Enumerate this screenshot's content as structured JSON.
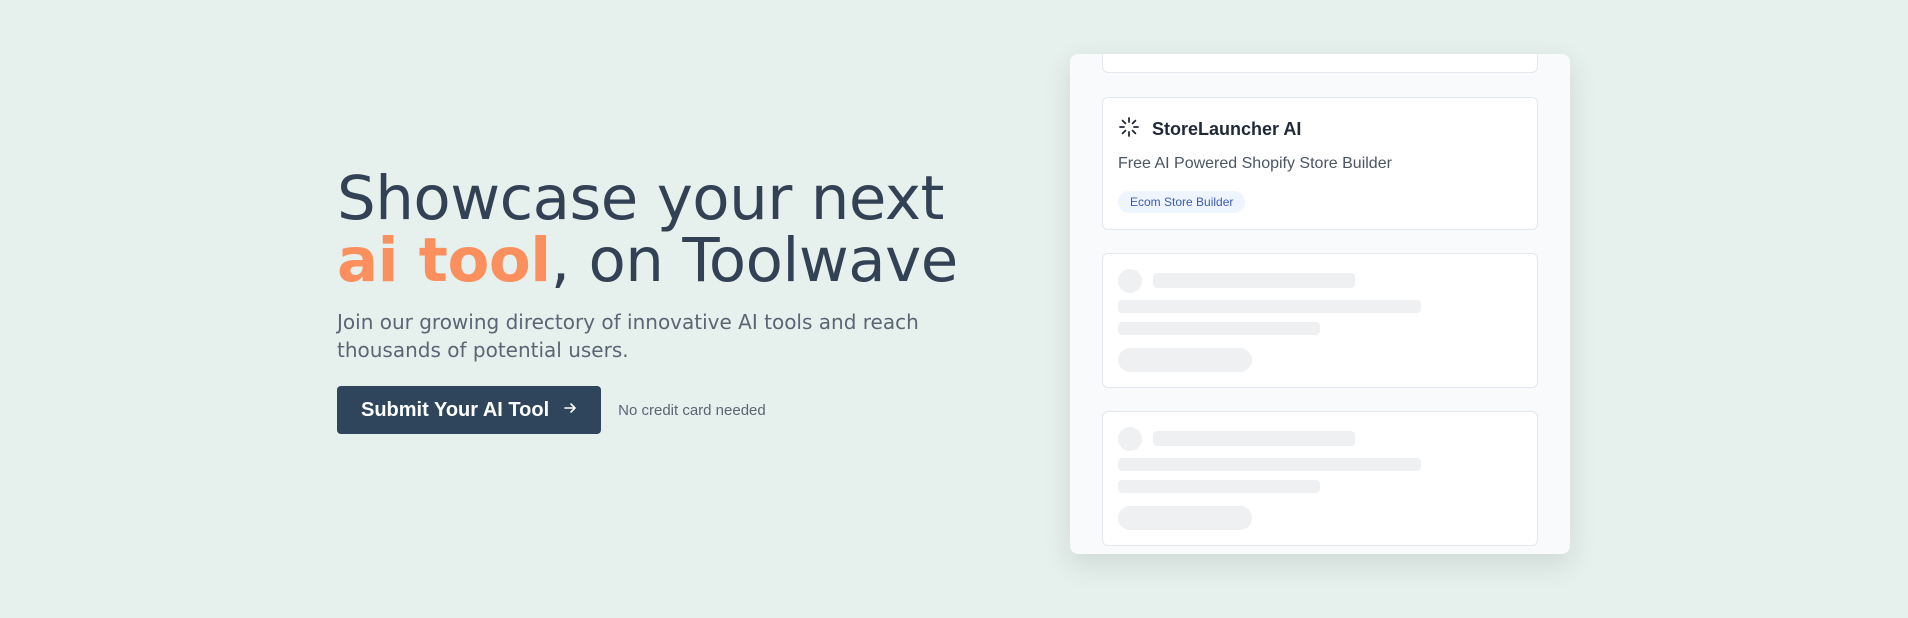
{
  "hero": {
    "headline_line1": "Showcase your next",
    "headline_accent": "ai tool",
    "headline_rest": ", on Toolwave",
    "subtitle": "Join our growing directory of innovative AI tools and reach thousands of potential users.",
    "cta_label": "Submit Your AI Tool",
    "cta_icon": "arrow-right-icon",
    "note": "No credit card needed"
  },
  "preview": {
    "tool": {
      "icon": "loader-icon",
      "name": "StoreLauncher AI",
      "description": "Free AI Powered Shopify Store Builder",
      "tag": "Ecom Store Builder"
    }
  },
  "colors": {
    "background": "#e6f0ec",
    "accent": "#fb8f5e",
    "heading": "#334155",
    "button": "#2f455c",
    "tag_bg": "#eef5ff",
    "tag_text": "#3b5bb5"
  }
}
